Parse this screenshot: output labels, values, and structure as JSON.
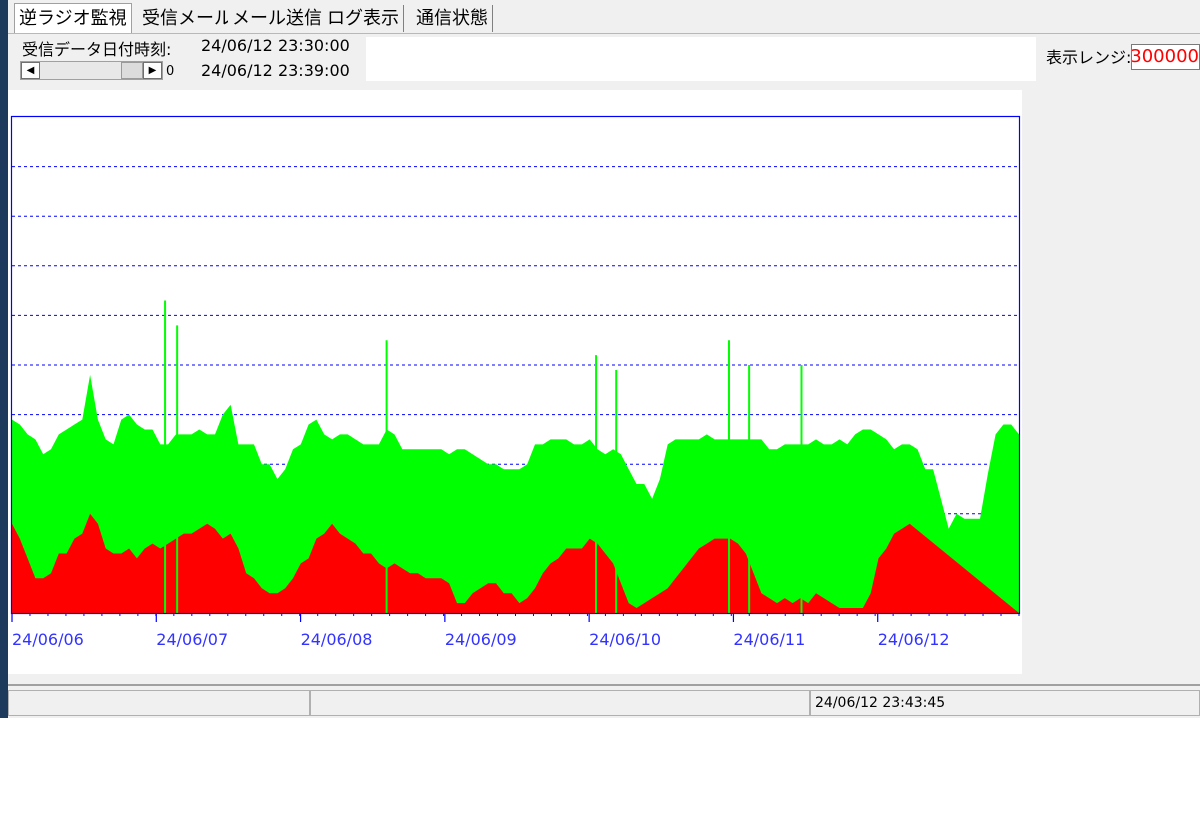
{
  "tabs": [
    {
      "label": "逆ラジオ監視",
      "active": true
    },
    {
      "label": "受信メール",
      "active": false
    },
    {
      "label": "メール送信",
      "active": false
    },
    {
      "label": "ログ表示",
      "active": false
    },
    {
      "label": "通信状態",
      "active": false
    }
  ],
  "receive": {
    "label": "受信データ日付時刻:",
    "start": "24/06/12 23:30:00",
    "end": "24/06/12 23:39:00",
    "scroll_value": "0"
  },
  "range": {
    "label": "表示レンジ:",
    "value": "300000"
  },
  "status": {
    "panels": [
      "",
      "",
      "24/06/12 23:43:45"
    ]
  },
  "chart_data": {
    "type": "area",
    "x_range": [
      "24/06/06",
      "24/06/12 23:30"
    ],
    "tick_labels": [
      "24/06/06",
      "24/06/07",
      "24/06/08",
      "24/06/09",
      "24/06/10",
      "24/06/11",
      "24/06/12"
    ],
    "grid": "horizontal dotted",
    "y_gridlines": 9,
    "colors": {
      "series_total": "#00ff00",
      "series_base": "#ff0000",
      "frame": "#0000ff",
      "tick_text": "#3333ff"
    },
    "series": [
      {
        "color": "green",
        "values": [
          3.9,
          3.8,
          3.6,
          3.5,
          3.2,
          3.3,
          3.6,
          3.7,
          3.8,
          3.9,
          4.8,
          3.9,
          3.5,
          3.4,
          3.9,
          4.0,
          3.8,
          3.7,
          3.7,
          3.4,
          3.4,
          3.6,
          3.6,
          3.6,
          3.7,
          3.6,
          3.6,
          4.0,
          4.2,
          3.4,
          3.4,
          3.4,
          3.0,
          3.0,
          2.7,
          2.9,
          3.3,
          3.4,
          3.8,
          3.9,
          3.6,
          3.5,
          3.6,
          3.6,
          3.5,
          3.4,
          3.4,
          3.4,
          3.7,
          3.6,
          3.3,
          3.3,
          3.3,
          3.3,
          3.3,
          3.3,
          3.2,
          3.3,
          3.3,
          3.2,
          3.1,
          3.0,
          3.0,
          2.9,
          2.9,
          2.9,
          3.0,
          3.4,
          3.4,
          3.5,
          3.5,
          3.5,
          3.4,
          3.4,
          3.5,
          3.3,
          3.2,
          3.3,
          3.2,
          2.9,
          2.6,
          2.6,
          2.3,
          2.7,
          3.4,
          3.5,
          3.5,
          3.5,
          3.5,
          3.6,
          3.5,
          3.5,
          3.5,
          3.5,
          3.5,
          3.5,
          3.5,
          3.3,
          3.3,
          3.4,
          3.4,
          3.4,
          3.4,
          3.5,
          3.4,
          3.4,
          3.5,
          3.4,
          3.6,
          3.7,
          3.7,
          3.6,
          3.5,
          3.3,
          3.4,
          3.4,
          3.3,
          2.9,
          2.9,
          2.3,
          1.7,
          2.0,
          1.9,
          1.9,
          1.9,
          2.8,
          3.6,
          3.8,
          3.8,
          3.6
        ],
        "note": "upper (total) values, approx. gridline units"
      },
      {
        "color": "red",
        "values": [
          1.8,
          1.5,
          1.1,
          0.7,
          0.7,
          0.8,
          1.2,
          1.2,
          1.5,
          1.6,
          2.0,
          1.8,
          1.3,
          1.2,
          1.2,
          1.3,
          1.1,
          1.3,
          1.4,
          1.3,
          1.4,
          1.5,
          1.6,
          1.6,
          1.7,
          1.8,
          1.7,
          1.5,
          1.6,
          1.3,
          0.8,
          0.7,
          0.5,
          0.4,
          0.4,
          0.5,
          0.7,
          1.0,
          1.1,
          1.5,
          1.6,
          1.8,
          1.6,
          1.5,
          1.4,
          1.2,
          1.2,
          1.0,
          0.9,
          1.0,
          0.9,
          0.8,
          0.8,
          0.7,
          0.7,
          0.7,
          0.6,
          0.2,
          0.2,
          0.4,
          0.5,
          0.6,
          0.6,
          0.4,
          0.4,
          0.2,
          0.3,
          0.5,
          0.8,
          1.0,
          1.1,
          1.3,
          1.3,
          1.3,
          1.5,
          1.4,
          1.2,
          1.0,
          0.6,
          0.2,
          0.1,
          0.2,
          0.3,
          0.4,
          0.5,
          0.7,
          0.9,
          1.1,
          1.3,
          1.4,
          1.5,
          1.5,
          1.5,
          1.4,
          1.2,
          0.8,
          0.4,
          0.3,
          0.2,
          0.3,
          0.2,
          0.3,
          0.2,
          0.4,
          0.3,
          0.2,
          0.1,
          0.1,
          0.1,
          0.1,
          0.4,
          1.1,
          1.3,
          1.6,
          1.7,
          1.8
        ],
        "note": "lower (base) values, approx. gridline units"
      }
    ]
  }
}
